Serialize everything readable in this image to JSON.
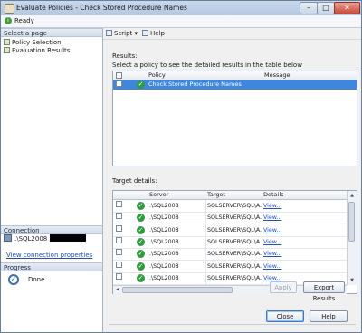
{
  "window": {
    "title": "Evaluate Policies - Check Stored Procedure Names",
    "status": "Ready"
  },
  "left": {
    "select_page_header": "Select a page",
    "pages": [
      "Policy Selection",
      "Evaluation Results"
    ],
    "connection_header": "Connection",
    "server_name": ".\\SQL2008",
    "view_connection_link": "View connection properties",
    "progress_header": "Progress",
    "progress_status": "Done"
  },
  "toolbar": {
    "script_label": "Script",
    "help_label": "Help"
  },
  "results": {
    "label": "Results:",
    "instruction": "Select a policy to see the detailed results in the table below",
    "columns": [
      "Policy",
      "Message"
    ],
    "rows": [
      {
        "policy": "Check Stored Procedure Names",
        "message": ""
      }
    ]
  },
  "target": {
    "label": "Target details:",
    "columns": [
      "Server",
      "Target",
      "Details"
    ],
    "rows": [
      {
        "server": ".\\SQL2008",
        "target": "SQLSERVER\\SQL\\A...",
        "details": "View..."
      },
      {
        "server": ".\\SQL2008",
        "target": "SQLSERVER\\SQL\\A...",
        "details": "View..."
      },
      {
        "server": ".\\SQL2008",
        "target": "SQLSERVER\\SQL\\A...",
        "details": "View..."
      },
      {
        "server": ".\\SQL2008",
        "target": "SQLSERVER\\SQL\\A...",
        "details": "View..."
      },
      {
        "server": ".\\SQL2008",
        "target": "SQLSERVER\\SQL\\A...",
        "details": "View..."
      },
      {
        "server": ".\\SQL2008",
        "target": "SQLSERVER\\SQL\\A...",
        "details": "View..."
      },
      {
        "server": ".\\SQL2008",
        "target": "SQLSERVER\\SQL\\A...",
        "details": "View..."
      }
    ]
  },
  "buttons": {
    "apply": "Apply",
    "export": "Export Results",
    "close": "Close",
    "help": "Help"
  },
  "colors": {
    "selection": "#3f86dc",
    "success": "#2f9d3e",
    "link": "#1f4fb8"
  }
}
